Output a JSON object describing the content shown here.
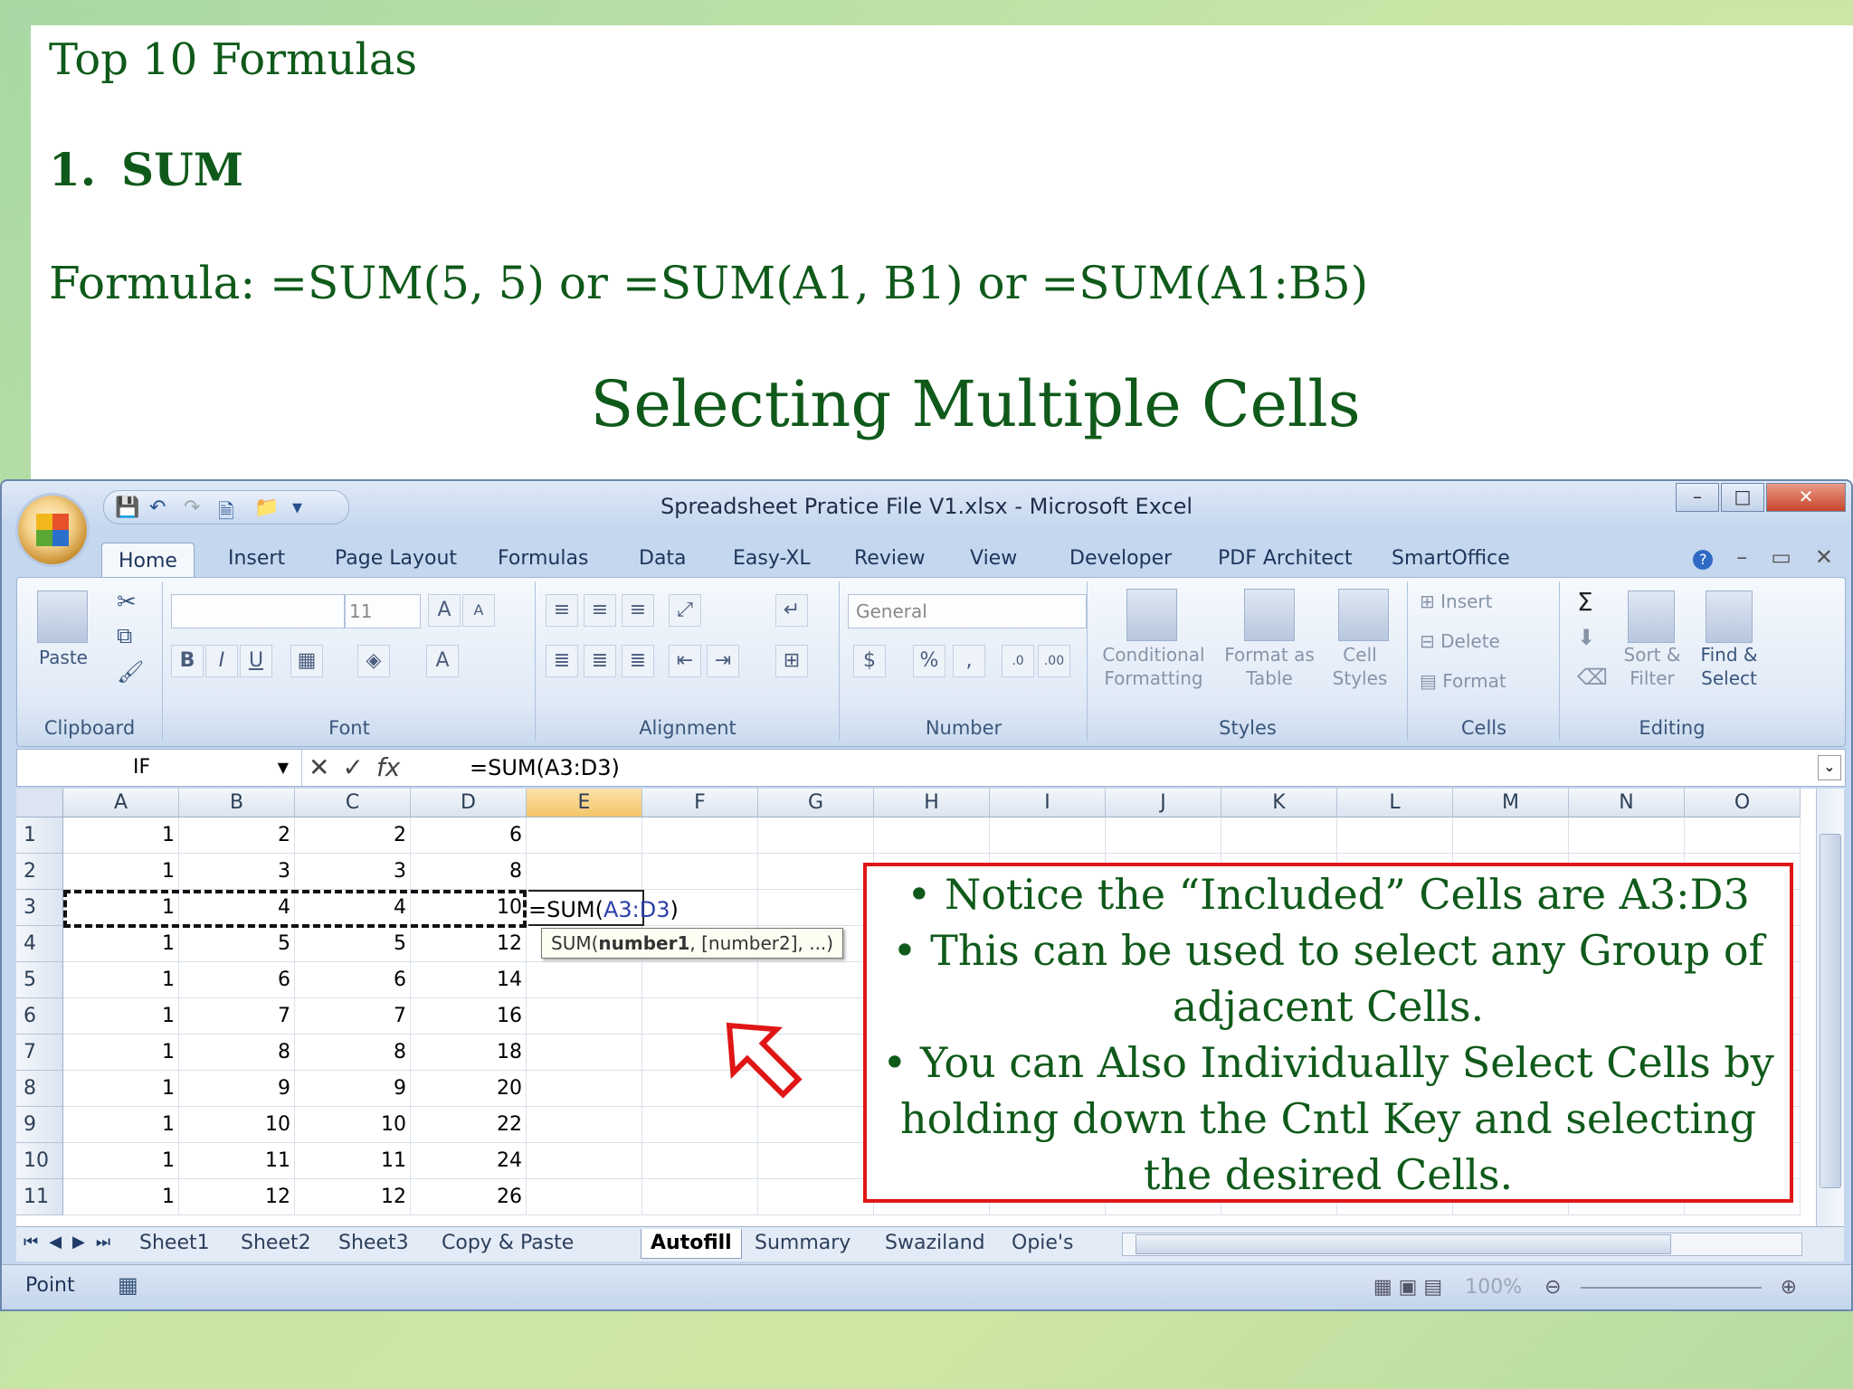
{
  "slide": {
    "heading": "Top 10 Formulas",
    "item_number": "1.",
    "item_title": "SUM",
    "formula_line": "Formula: =SUM(5, 5) or =SUM(A1, B1) or =SUM(A1:B5)",
    "subtitle": "Selecting Multiple Cells"
  },
  "excel": {
    "window_title": "Spreadsheet Pratice File V1.xlsx - Microsoft Excel",
    "tabs": [
      "Home",
      "Insert",
      "Page Layout",
      "Formulas",
      "Data",
      "Easy-XL",
      "Review",
      "View",
      "Developer",
      "PDF Architect",
      "SmartOffice"
    ],
    "ribbon": {
      "clipboard_label": "Clipboard",
      "paste_label": "Paste",
      "font_label": "Font",
      "font_size": "11",
      "alignment_label": "Alignment",
      "number_label": "Number",
      "number_format": "General",
      "styles_label": "Styles",
      "conditional_formatting": "Conditional Formatting",
      "format_as_table": "Format as Table",
      "cell_styles": "Cell Styles",
      "cells_label": "Cells",
      "insert": "Insert",
      "delete": "Delete",
      "format": "Format",
      "editing_label": "Editing",
      "sort_filter": "Sort & Filter",
      "find_select": "Find & Select"
    },
    "name_box": "IF",
    "formula": "=SUM(A3:D3)",
    "columns": [
      "A",
      "B",
      "C",
      "D",
      "E",
      "F",
      "G",
      "H",
      "I",
      "J",
      "K",
      "L",
      "M",
      "N",
      "O"
    ],
    "rows": [
      [
        "1",
        "1",
        "2",
        "2",
        "6"
      ],
      [
        "2",
        "1",
        "3",
        "3",
        "8"
      ],
      [
        "3",
        "1",
        "4",
        "4",
        "10"
      ],
      [
        "4",
        "1",
        "5",
        "5",
        "12"
      ],
      [
        "5",
        "1",
        "6",
        "6",
        "14"
      ],
      [
        "6",
        "1",
        "7",
        "7",
        "16"
      ],
      [
        "7",
        "1",
        "8",
        "8",
        "18"
      ],
      [
        "8",
        "1",
        "9",
        "9",
        "20"
      ],
      [
        "9",
        "1",
        "10",
        "10",
        "22"
      ],
      [
        "10",
        "1",
        "11",
        "11",
        "24"
      ],
      [
        "11",
        "1",
        "12",
        "12",
        "26"
      ]
    ],
    "edit_cell_prefix": "=SUM(",
    "edit_cell_ref": "A3:D3",
    "edit_cell_suffix": ")",
    "tooltip_prefix": "SUM(",
    "tooltip_bold": "number1",
    "tooltip_suffix": ", [number2], ...)",
    "sheet_tabs": [
      "Sheet1",
      "Sheet2",
      "Sheet3",
      "Copy & Paste",
      "Autofill",
      "Summary",
      "Swaziland",
      "Opie's"
    ],
    "active_sheet": "Autofill",
    "status": "Point",
    "zoom": "100%"
  },
  "callout": {
    "lines": [
      "• Notice the “Included” Cells are A3:D3",
      "• This can be used to select any Group of",
      "adjacent Cells.",
      "• You can Also Individually Select Cells by",
      "holding down the Cntl Key and selecting",
      "the desired Cells."
    ]
  },
  "colors": {
    "slide_text": "#0f5a1a",
    "callout_border": "#e01515",
    "arrow": "#e01515"
  }
}
